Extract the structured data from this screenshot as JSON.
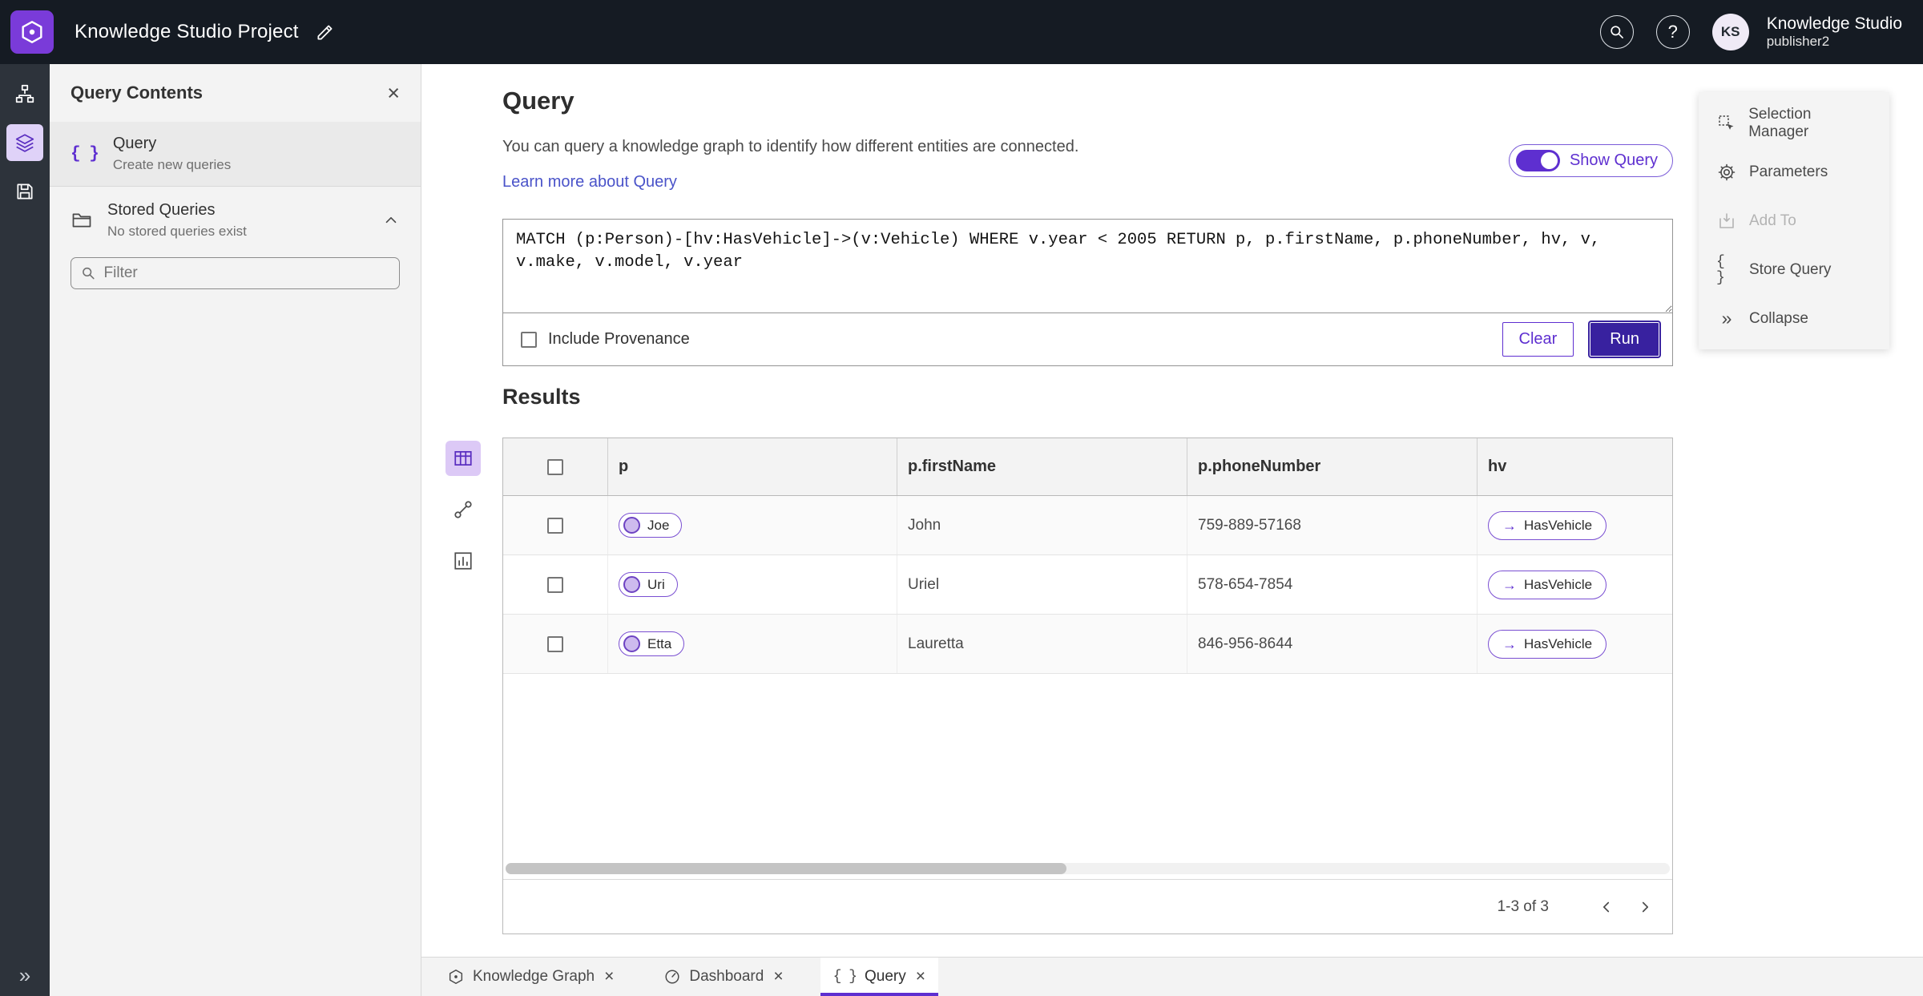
{
  "colors": {
    "accent": "#5E2FD0",
    "run_button": "#38219F",
    "link": "#4A53C9",
    "header_bg": "#151B23",
    "logo_purple": "#7A3BD9"
  },
  "glyphs": {
    "braces": "{ }",
    "arrow_right": "→",
    "collapse": "»",
    "close": "×",
    "question": "?"
  },
  "header": {
    "title": "Knowledge Studio Project",
    "user_initials": "KS",
    "user_name": "Knowledge Studio",
    "user_role": "publisher2"
  },
  "sidebar": {
    "title": "Query Contents",
    "query_item": {
      "label": "Query",
      "description": "Create new queries"
    },
    "stored_queries": {
      "label": "Stored Queries",
      "description": "No stored queries exist"
    },
    "filter_placeholder": "Filter"
  },
  "query_panel": {
    "heading": "Query",
    "description": "You can query a knowledge graph to identify how different entities are connected.",
    "learn_more": "Learn more about Query",
    "show_query": "Show Query",
    "query_text": "MATCH (p:Person)-[hv:HasVehicle]->(v:Vehicle) WHERE v.year < 2005 RETURN p, p.firstName, p.phoneNumber, hv, v, v.make, v.model, v.year",
    "include_provenance": "Include Provenance",
    "clear": "Clear",
    "run": "Run"
  },
  "results": {
    "heading": "Results",
    "columns": [
      "p",
      "p.firstName",
      "p.phoneNumber",
      "hv"
    ],
    "rows": [
      {
        "entity": "Joe",
        "first_name": "John",
        "phone": "759-889-57168",
        "relationship": "HasVehicle"
      },
      {
        "entity": "Uri",
        "first_name": "Uriel",
        "phone": "578-654-7854",
        "relationship": "HasVehicle"
      },
      {
        "entity": "Etta",
        "first_name": "Lauretta",
        "phone": "846-956-8644",
        "relationship": "HasVehicle"
      }
    ],
    "pagination": "1-3 of 3"
  },
  "tools_panel": {
    "items": [
      {
        "label": "Selection Manager"
      },
      {
        "label": "Parameters"
      },
      {
        "label": "Add To"
      },
      {
        "label": "Store Query"
      },
      {
        "label": "Collapse"
      }
    ]
  },
  "tabs": [
    {
      "label": "Knowledge Graph"
    },
    {
      "label": "Dashboard"
    },
    {
      "label": "Query"
    }
  ]
}
